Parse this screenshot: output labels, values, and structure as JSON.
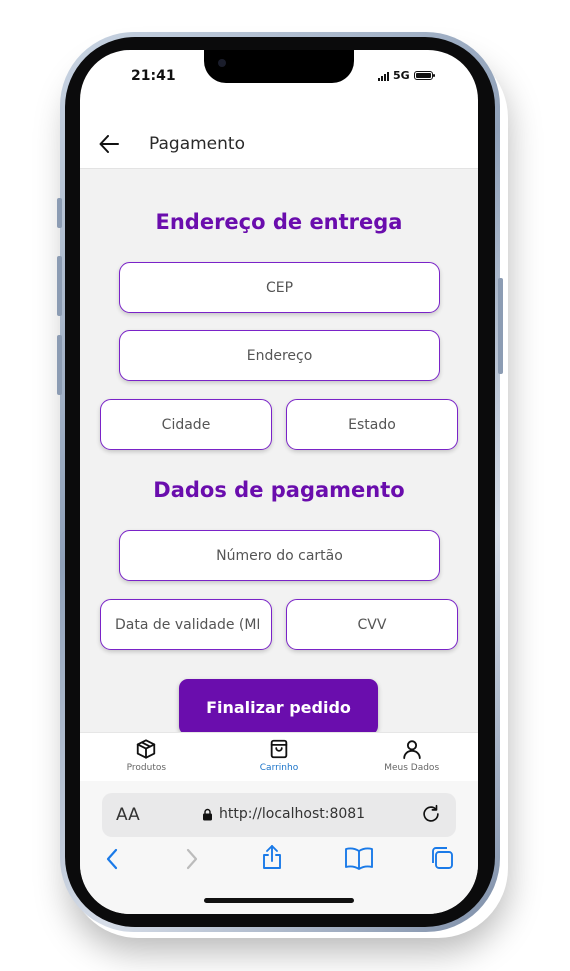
{
  "status_bar": {
    "time": "21:41",
    "network": "5G"
  },
  "header": {
    "title": "Pagamento"
  },
  "shipping": {
    "title": "Endereço de entrega",
    "cep_placeholder": "CEP",
    "address_placeholder": "Endereço",
    "city_placeholder": "Cidade",
    "state_placeholder": "Estado"
  },
  "payment": {
    "title": "Dados de pagamento",
    "card_number_placeholder": "Número do cartão",
    "expiry_placeholder": "Data de validade (MM/AA)",
    "cvv_placeholder": "CVV"
  },
  "submit_label": "Finalizar pedido",
  "tabs": [
    {
      "label": "Produtos",
      "icon": "box-icon",
      "active": false
    },
    {
      "label": "Carrinho",
      "icon": "shopping-bag-icon",
      "active": true
    },
    {
      "label": "Meus Dados",
      "icon": "user-icon",
      "active": false
    }
  ],
  "browser": {
    "text_size_label": "AA",
    "url": "http://localhost:8081"
  },
  "colors": {
    "accent": "#6a0dad",
    "active_tab": "#1a73c9",
    "ios_blue": "#1a7ae8"
  }
}
